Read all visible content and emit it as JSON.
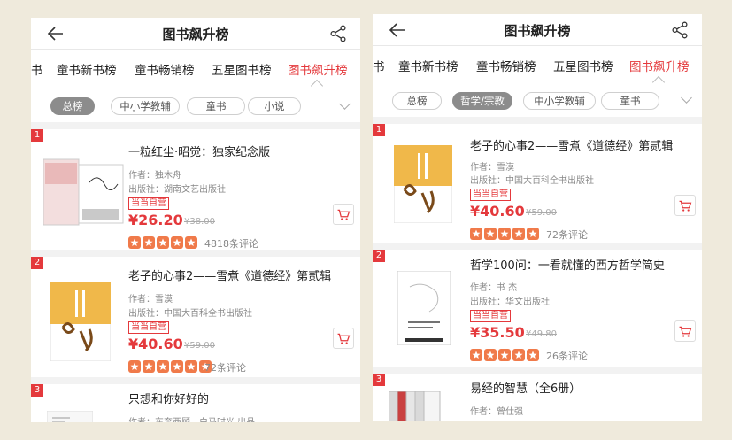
{
  "colors": {
    "accent": "#e4393c",
    "star": "#f07a4a",
    "chip_active": "#8c8c8c"
  },
  "left": {
    "header": {
      "title": "图书飙升榜",
      "back_icon": "arrow-left-icon",
      "share_icon": "share-icon"
    },
    "tabs": [
      "书",
      "童书新书榜",
      "童书畅销榜",
      "五星图书榜",
      "图书飙升榜"
    ],
    "filters": [
      "总榜",
      "中小学教辅",
      "童书",
      "小说"
    ],
    "items": [
      {
        "rank": "1",
        "title": "一粒红尘·昭觉：独家纪念版",
        "author": "作者：独木舟",
        "publisher": "出版社：湖南文艺出版社",
        "badge": "当当自营",
        "price": "¥26.20",
        "orig": "¥38.00",
        "reviews": "4818条评论",
        "rating": 5
      },
      {
        "rank": "2",
        "title": "老子的心事2——雪煮《道德经》第贰辑",
        "author": "作者：雪漠",
        "publisher": "出版社：中国大百科全书出版社",
        "badge": "当当自营",
        "price": "¥40.60",
        "orig": "¥59.00",
        "reviews": "72条评论",
        "rating": 5
      },
      {
        "rank": "3",
        "title": "只想和你好好的",
        "author": "作者：东奔西顾，白马时光 出品"
      }
    ]
  },
  "right": {
    "header": {
      "title": "图书飙升榜",
      "back_icon": "arrow-left-icon",
      "share_icon": "share-icon"
    },
    "tabs": [
      "书",
      "童书新书榜",
      "童书畅销榜",
      "五星图书榜",
      "图书飙升榜"
    ],
    "filters": [
      "总榜",
      "哲学/宗教",
      "中小学教辅",
      "童书"
    ],
    "items": [
      {
        "rank": "1",
        "title": "老子的心事2——雪煮《道德经》第贰辑",
        "author": "作者：雪漠",
        "publisher": "出版社：中国大百科全书出版社",
        "badge": "当当自营",
        "price": "¥40.60",
        "orig": "¥59.00",
        "reviews": "72条评论",
        "rating": 5
      },
      {
        "rank": "2",
        "title": "哲学100问：一看就懂的西方哲学简史",
        "author": "作者：书 杰",
        "publisher": "出版社：华文出版社",
        "badge": "当当自营",
        "price": "¥35.50",
        "orig": "¥49.80",
        "reviews": "26条评论",
        "rating": 5
      },
      {
        "rank": "3",
        "title": "易经的智慧（全6册）",
        "author": "作者：曾仕强"
      }
    ]
  }
}
